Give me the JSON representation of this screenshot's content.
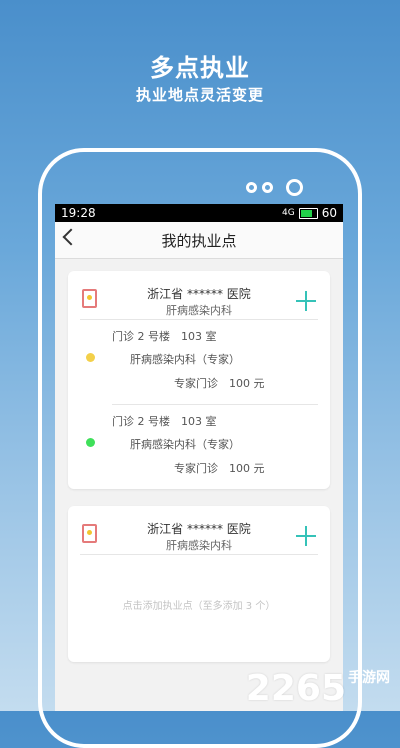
{
  "promo": {
    "title": "多点执业",
    "subtitle": "执业地点灵活变更"
  },
  "statusbar": {
    "time": "19:28",
    "battery": "60",
    "signal": "4G"
  },
  "navbar": {
    "title": "我的执业点"
  },
  "cards": [
    {
      "hospital": "浙江省 ****** 医院",
      "department": "肝病感染内科",
      "locations": [
        {
          "room": "门诊 2 号楼　103 室",
          "dept": "肝病感染内科（专家）",
          "fee": "专家门诊　100 元",
          "status_color": "#f3d04a"
        },
        {
          "room": "门诊 2 号楼　103 室",
          "dept": "肝病感染内科（专家）",
          "fee": "专家门诊　100 元",
          "status_color": "#3fe05a"
        }
      ]
    },
    {
      "hospital": "浙江省 ****** 医院",
      "department": "肝病感染内科",
      "add_hint": "点击添加执业点（至多添加 3 个）"
    }
  ],
  "watermark": {
    "number": "2265",
    "text": "手游网"
  },
  "colors": {
    "accent": "#35c2b8",
    "bookmark": "#e57a7a"
  }
}
